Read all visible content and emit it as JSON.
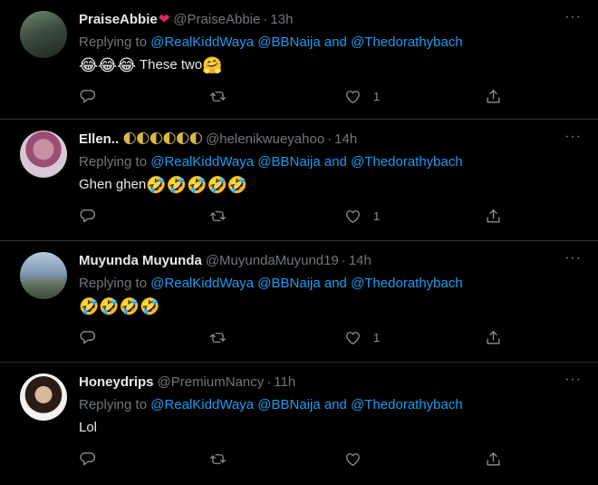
{
  "tweets": [
    {
      "name": "PraiseAbbie",
      "name_suffix": "❤",
      "handle": "@PraiseAbbie",
      "sep": "·",
      "time": "13h",
      "replying_prefix": "Replying to",
      "mentions": [
        "@RealKiddWaya",
        "@BBNaija",
        "and",
        "@Thedorathybach"
      ],
      "text_emoji_before": "😂😂😂",
      "text": " These two",
      "text_emoji_after": "🤗",
      "likes": "1",
      "avatar_icon": "avatar-dark-green"
    },
    {
      "name": "Ellen..",
      "name_suffix": "🌓🌓🌓🌓🌓🌓",
      "handle": "@helenikwueyahoo",
      "sep": "·",
      "time": "14h",
      "replying_prefix": "Replying to",
      "mentions": [
        "@RealKiddWaya",
        "@BBNaija",
        "and",
        "@Thedorathybach"
      ],
      "text_emoji_before": "",
      "text": "Ghen ghen",
      "text_emoji_after": "🤣🤣🤣🤣🤣",
      "likes": "1",
      "avatar_icon": "avatar-pink"
    },
    {
      "name": "Muyunda Muyunda",
      "name_suffix": "",
      "handle": "@MuyundaMuyund19",
      "sep": "·",
      "time": "14h",
      "replying_prefix": "Replying to",
      "mentions": [
        "@RealKiddWaya",
        "@BBNaija",
        "and",
        "@Thedorathybach"
      ],
      "text_emoji_before": "🤣🤣🤣🤣",
      "text": "",
      "text_emoji_after": "",
      "likes": "1",
      "avatar_icon": "avatar-lake"
    },
    {
      "name": "Honeydrips",
      "name_suffix": "",
      "handle": "@PremiumNancy",
      "sep": "·",
      "time": "11h",
      "replying_prefix": "Replying to",
      "mentions": [
        "@RealKiddWaya",
        "@BBNaija",
        "and",
        "@Thedorathybach"
      ],
      "text_emoji_before": "",
      "text": "Lol",
      "text_emoji_after": "",
      "likes": "",
      "avatar_icon": "avatar-portrait"
    }
  ],
  "more_icon": "···",
  "colors": {
    "background": "#000000",
    "mention": "#1d9bf0",
    "muted": "#71767b",
    "divider": "#2f3336"
  }
}
